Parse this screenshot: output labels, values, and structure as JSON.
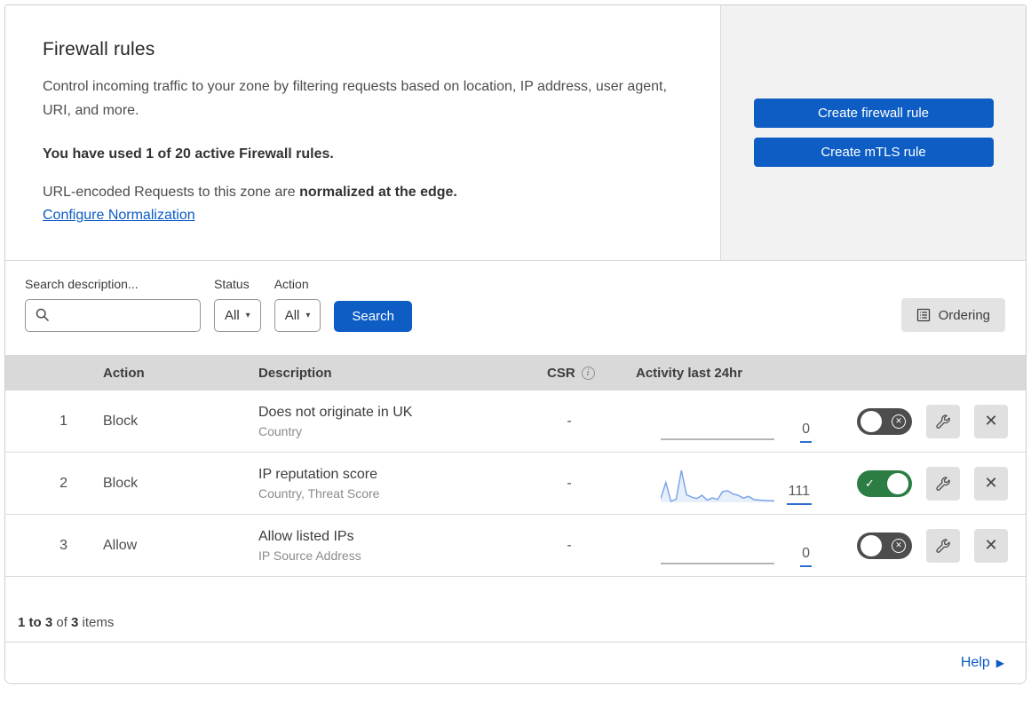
{
  "header": {
    "title": "Firewall rules",
    "description": "Control incoming traffic to your zone by filtering requests based on location, IP address, user agent, URI, and more.",
    "usage_notice": "You have used 1 of 20 active Firewall rules.",
    "normalization_prefix": "URL-encoded Requests to this zone are ",
    "normalization_bold": "normalized at the edge.",
    "normalization_link": "Configure Normalization"
  },
  "actions_panel": {
    "create_firewall_rule_label": "Create firewall rule",
    "create_mtls_rule_label": "Create mTLS rule"
  },
  "filters": {
    "search_label": "Search description...",
    "search_value": "",
    "status_label": "Status",
    "status_value": "All",
    "action_label": "Action",
    "action_value": "All",
    "search_button_label": "Search",
    "ordering_button_label": "Ordering"
  },
  "table": {
    "columns": {
      "action": "Action",
      "description": "Description",
      "csr": "CSR",
      "activity": "Activity last 24hr"
    },
    "rows": [
      {
        "priority": "1",
        "action": "Block",
        "description": "Does not originate in UK",
        "criteria": "Country",
        "csr": "-",
        "activity_count": "0",
        "enabled": false
      },
      {
        "priority": "2",
        "action": "Block",
        "description": "IP reputation score",
        "criteria": "Country, Threat Score",
        "csr": "-",
        "activity_count": "111",
        "enabled": true
      },
      {
        "priority": "3",
        "action": "Allow",
        "description": "Allow listed IPs",
        "criteria": "IP Source Address",
        "csr": "-",
        "activity_count": "0",
        "enabled": false
      }
    ]
  },
  "chart_data": {
    "type": "line",
    "title": "Activity last 24hr sparkline for rule 2 (IP reputation score)",
    "x_description": "time across last 24 hours, unlabeled sparkline axis",
    "values": [
      12,
      62,
      3,
      10,
      100,
      24,
      16,
      12,
      22,
      7,
      14,
      9,
      34,
      36,
      26,
      22,
      13,
      19,
      9,
      7,
      6,
      5,
      5
    ],
    "ylim": [
      0,
      100
    ],
    "unit": "relative request activity (peak normalized to 100)",
    "total_events_label": "111",
    "legend": "none",
    "grid": "off",
    "line_color": "#7aa5e8",
    "fill_color": "rgba(122,165,232,0.18)",
    "flat_rows_note": "rules 1 and 3 show a flat zero-activity gray baseline with count 0"
  },
  "footer": {
    "range_bold": "1 to 3",
    "of_text": " of ",
    "total_bold": "3",
    "items_text": " items"
  },
  "help": {
    "label": "Help"
  },
  "glyphs": {
    "caret": "▾",
    "check": "✓",
    "cross": "✕",
    "help_arrow": "▶",
    "info": "i",
    "csr_dash": "-"
  },
  "colors": {
    "accent_blue": "#0d5dc5",
    "link_blue": "#0b5bc4",
    "panel_gray": "#f2f2f2",
    "table_header_gray": "#d9d9d9",
    "toggle_off_gray": "#4d4d4d",
    "toggle_on_green": "#2b7d44",
    "sparkline_blue": "#7aa5e8",
    "count_underline_blue": "#2c6fcf"
  }
}
